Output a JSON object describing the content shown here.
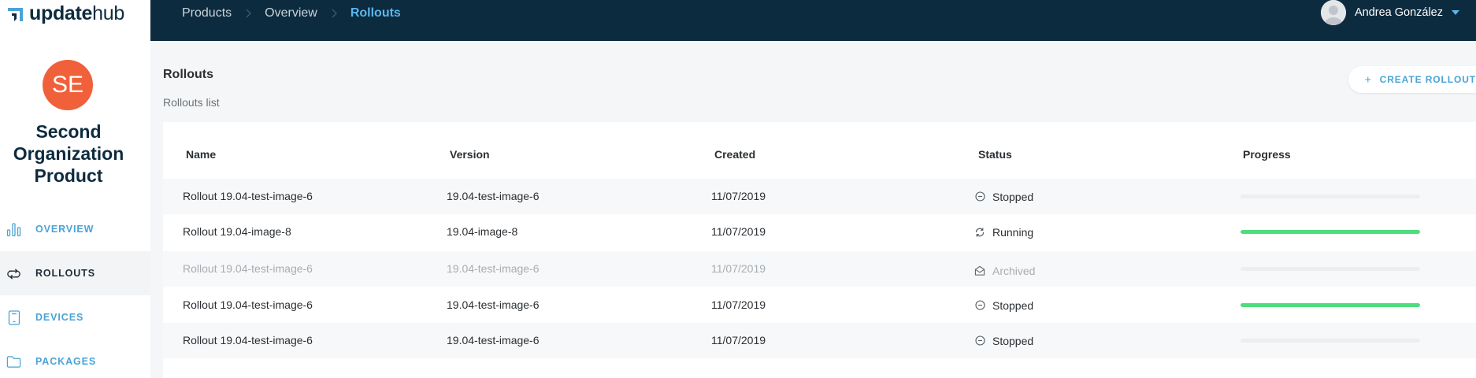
{
  "app": {
    "logo_bold": "update",
    "logo_light": "hub"
  },
  "sidebar": {
    "avatar_initials": "SE",
    "product_name": "Second Organization Product",
    "items": [
      {
        "label": "OVERVIEW",
        "icon": "chart-bars-icon",
        "active": false
      },
      {
        "label": "ROLLOUTS",
        "icon": "rollout-cycle-icon",
        "active": true
      },
      {
        "label": "DEVICES",
        "icon": "device-icon",
        "active": false
      },
      {
        "label": "PACKAGES",
        "icon": "folder-icon",
        "active": false
      }
    ]
  },
  "topbar": {
    "breadcrumb": [
      "Products",
      "Overview",
      "Rollouts"
    ],
    "user_name": "Andrea González"
  },
  "main": {
    "title": "Rollouts",
    "subtitle": "Rollouts list",
    "create_button": "CREATE ROLLOUT"
  },
  "table": {
    "columns": [
      "Name",
      "Version",
      "Created",
      "Status",
      "Progress"
    ],
    "rows": [
      {
        "name": "Rollout 19.04-test-image-6",
        "version": "19.04-test-image-6",
        "created": "11/07/2019",
        "status": "Stopped",
        "status_icon": "stopped-icon",
        "progress": 0,
        "archived": false
      },
      {
        "name": "Rollout 19.04-image-8",
        "version": "19.04-image-8",
        "created": "11/07/2019",
        "status": "Running",
        "status_icon": "running-icon",
        "progress": 1,
        "archived": false
      },
      {
        "name": "Rollout 19.04-test-image-6",
        "version": "19.04-test-image-6",
        "created": "11/07/2019",
        "status": "Archived",
        "status_icon": "archived-icon",
        "progress": 0,
        "archived": true
      },
      {
        "name": "Rollout 19.04-test-image-6",
        "version": "19.04-test-image-6",
        "created": "11/07/2019",
        "status": "Stopped",
        "status_icon": "stopped-icon",
        "progress": 1,
        "archived": false
      },
      {
        "name": "Rollout 19.04-test-image-6",
        "version": "19.04-test-image-6",
        "created": "11/07/2019",
        "status": "Stopped",
        "status_icon": "stopped-icon",
        "progress": 0,
        "archived": false
      }
    ]
  },
  "colors": {
    "topbar_bg": "#0d2b3e",
    "accent": "#4aa3d6",
    "avatar_bg": "#f0603a",
    "progress_fill": "#4fdc7e"
  }
}
